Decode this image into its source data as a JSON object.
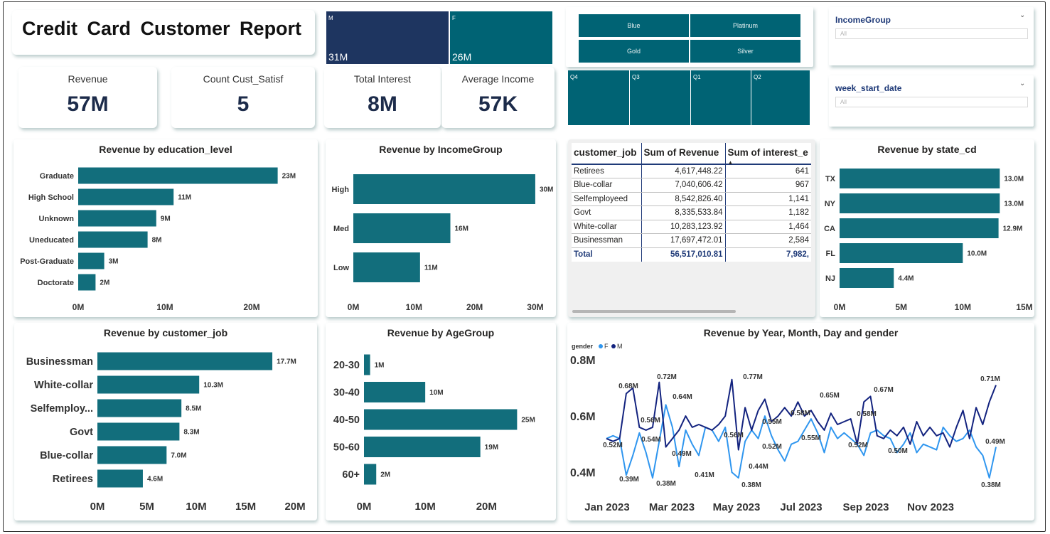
{
  "report_title": "Credit Card Customer Report",
  "kpis": [
    {
      "label": "Revenue",
      "value": "57M"
    },
    {
      "label": "Count Cust_Satisf",
      "value": "5"
    },
    {
      "label": "Total Interest",
      "value": "8M"
    },
    {
      "label": "Average Income",
      "value": "57K"
    }
  ],
  "gender_tiles": [
    {
      "label": "M",
      "value": "31M",
      "color": "#1e3560"
    },
    {
      "label": "F",
      "value": "26M",
      "color": "#006374"
    }
  ],
  "card_category_slicer": [
    "Blue",
    "Platinum",
    "Gold",
    "Silver"
  ],
  "quarter_tiles": [
    "Q4",
    "Q3",
    "Q1",
    "Q2"
  ],
  "slicers": [
    {
      "label": "IncomeGroup",
      "value": "All"
    },
    {
      "label": "week_start_date",
      "value": "All"
    }
  ],
  "colors": {
    "bar": "#126e7c",
    "series_f": "#2f96ef",
    "series_m": "#13237f",
    "tile_teal": "#006374",
    "tile_navy": "#1e3560"
  },
  "charts": {
    "education": {
      "title": "Revenue by education_level",
      "categories": [
        "Graduate",
        "High School",
        "Unknown",
        "Uneducated",
        "Post-Graduate",
        "Doctorate"
      ],
      "values": [
        23,
        11,
        9,
        8,
        3,
        2
      ],
      "labels": [
        "23M",
        "11M",
        "9M",
        "8M",
        "3M",
        "2M"
      ],
      "ticks": [
        "0M",
        "10M",
        "20M"
      ]
    },
    "income": {
      "title": "Revenue by IncomeGroup",
      "categories": [
        "High",
        "Med",
        "Low"
      ],
      "values": [
        30,
        16,
        11
      ],
      "labels": [
        "30M",
        "16M",
        "11M"
      ],
      "ticks": [
        "0M",
        "10M",
        "20M",
        "30M"
      ]
    },
    "state": {
      "title": "Revenue by state_cd",
      "categories": [
        "TX",
        "NY",
        "CA",
        "FL",
        "NJ"
      ],
      "values": [
        13.0,
        13.0,
        12.9,
        10.0,
        4.4
      ],
      "labels": [
        "13.0M",
        "13.0M",
        "12.9M",
        "10.0M",
        "4.4M"
      ],
      "ticks": [
        "0M",
        "5M",
        "10M",
        "15M"
      ]
    },
    "job": {
      "title": "Revenue by customer_job",
      "categories": [
        "Businessman",
        "White-collar",
        "Selfemploy...",
        "Govt",
        "Blue-collar",
        "Retirees"
      ],
      "values": [
        17.7,
        10.3,
        8.5,
        8.3,
        7.0,
        4.6
      ],
      "labels": [
        "17.7M",
        "10.3M",
        "8.5M",
        "8.3M",
        "7.0M",
        "4.6M"
      ],
      "ticks": [
        "0M",
        "5M",
        "10M",
        "15M",
        "20M"
      ]
    },
    "age": {
      "title": "Revenue by AgeGroup",
      "categories": [
        "20-30",
        "30-40",
        "40-50",
        "50-60",
        "60+"
      ],
      "values": [
        1,
        10,
        25,
        19,
        2
      ],
      "labels": [
        "1M",
        "10M",
        "25M",
        "19M",
        "2M"
      ],
      "ticks": [
        "0M",
        "10M",
        "20M"
      ]
    }
  },
  "job_table": {
    "headers": [
      "customer_job",
      "Sum of Revenue",
      "Sum of interest_e"
    ],
    "rows": [
      [
        "Retirees",
        "4,617,448.22",
        "641"
      ],
      [
        "Blue-collar",
        "7,040,606.42",
        "967"
      ],
      [
        "Selfemployeed",
        "8,542,826.40",
        "1,141"
      ],
      [
        "Govt",
        "8,335,533.84",
        "1,182"
      ],
      [
        "White-collar",
        "10,283,123.92",
        "1,464"
      ],
      [
        "Businessman",
        "17,697,472.01",
        "2,584"
      ]
    ],
    "total": [
      "Total",
      "56,517,010.81",
      "7,982,"
    ]
  },
  "chart_data": {
    "type": "line",
    "title": "Revenue by Year, Month, Day and gender",
    "legend_title": "gender",
    "legend": [
      "F",
      "M"
    ],
    "legend_position": "top-left",
    "ylim": [
      0.35,
      0.8
    ],
    "y_ticks": [
      "0.4M",
      "0.6M",
      "0.8M"
    ],
    "x_ticks": [
      "Jan 2023",
      "Mar 2023",
      "May 2023",
      "Jul 2023",
      "Sep 2023",
      "Nov 2023"
    ],
    "series": [
      {
        "name": "F",
        "values": [
          0.52,
          0.53,
          0.52,
          0.39,
          0.46,
          0.54,
          0.47,
          0.38,
          0.51,
          0.64,
          0.56,
          0.42,
          0.55,
          0.5,
          0.46,
          0.56,
          0.55,
          0.51,
          0.56,
          0.4,
          0.38,
          0.51,
          0.55,
          0.52,
          0.6,
          0.53,
          0.48,
          0.44,
          0.5,
          0.51,
          0.55,
          0.59,
          0.54,
          0.47,
          0.56,
          0.52,
          0.54,
          0.52,
          0.5,
          0.46,
          0.54,
          0.55,
          0.53,
          0.52,
          0.47,
          0.5,
          0.54,
          0.47,
          0.5,
          0.49,
          0.48,
          0.56,
          0.53,
          0.51,
          0.52,
          0.55,
          0.49,
          0.46,
          0.38,
          0.49
        ]
      },
      {
        "name": "M",
        "values": [
          0.52,
          0.51,
          0.52,
          0.68,
          0.7,
          0.56,
          0.55,
          0.56,
          0.72,
          0.49,
          0.52,
          0.55,
          0.6,
          0.56,
          0.57,
          0.56,
          0.55,
          0.57,
          0.6,
          0.73,
          0.48,
          0.63,
          0.55,
          0.62,
          0.66,
          0.58,
          0.6,
          0.63,
          0.6,
          0.65,
          0.6,
          0.62,
          0.58,
          0.55,
          0.61,
          0.57,
          0.58,
          0.59,
          0.5,
          0.65,
          0.67,
          0.53,
          0.52,
          0.55,
          0.53,
          0.56,
          0.5,
          0.58,
          0.53,
          0.56,
          0.53,
          0.54,
          0.49,
          0.56,
          0.62,
          0.52,
          0.63,
          0.57,
          0.65,
          0.71
        ]
      }
    ],
    "annotations": [
      "0.52M",
      "0.68M",
      "0.39M",
      "0.54M",
      "0.56M",
      "0.72M",
      "0.38M",
      "0.49M",
      "0.64M",
      "0.41M",
      "0.56M",
      "0.77M",
      "0.38M",
      "0.55M",
      "0.52M",
      "0.44M",
      "0.58M",
      "0.55M",
      "0.65M",
      "0.52M",
      "0.58M",
      "0.67M",
      "0.50M",
      "0.49M",
      "0.38M",
      "0.71M"
    ]
  }
}
